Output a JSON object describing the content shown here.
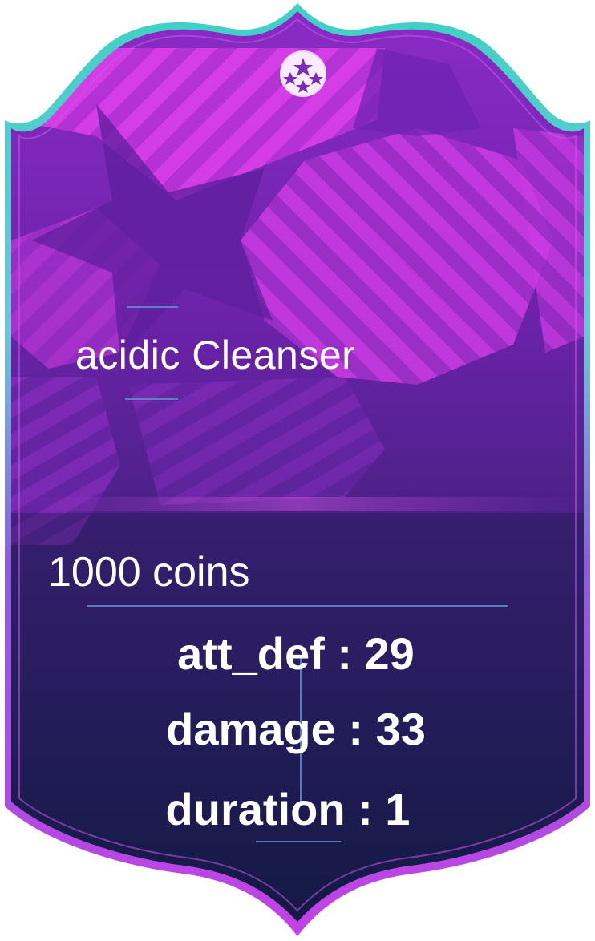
{
  "card": {
    "name": "acidic Cleanser",
    "price": "1000 coins",
    "badge_icon": "champions-league-ball-icon",
    "colors": {
      "border_top": "#3fd1c4",
      "border_bottom": "#b13de0",
      "bg_top": "#7a24b8",
      "bg_bottom": "#141a45",
      "accent_pattern": "#d63ae6",
      "divider": "#5f8fc9",
      "text": "#ffffff"
    },
    "stats": [
      {
        "label": "att_def : 29"
      },
      {
        "label": "damage : 33"
      },
      {
        "label": "duration : 1"
      }
    ]
  }
}
